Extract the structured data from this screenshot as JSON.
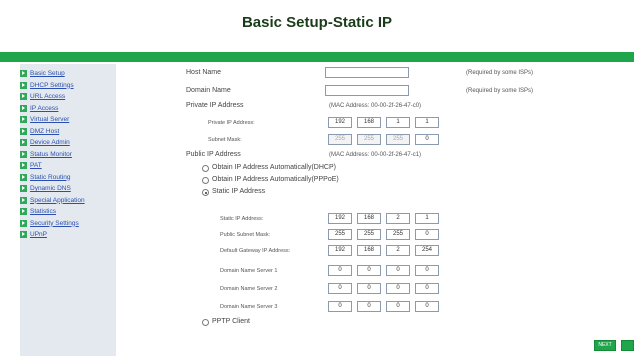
{
  "header": {
    "title": "Basic Setup-Static IP"
  },
  "sidebar": {
    "items": [
      {
        "label": "Basic Setup"
      },
      {
        "label": "DHCP Settings"
      },
      {
        "label": "URL Access"
      },
      {
        "label": "IP Access"
      },
      {
        "label": "Virtual Server"
      },
      {
        "label": "DMZ Host"
      },
      {
        "label": "Device Admin"
      },
      {
        "label": "Status Monitor"
      },
      {
        "label": "PAT"
      },
      {
        "label": "Static Routing"
      },
      {
        "label": "Dynamic DNS"
      },
      {
        "label": "Special Application"
      },
      {
        "label": "Statistics"
      },
      {
        "label": "Security Settings"
      },
      {
        "label": "UPnP"
      }
    ]
  },
  "form": {
    "host_name_label": "Host Name",
    "host_name_value": "",
    "domain_name_label": "Domain Name",
    "domain_name_value": "",
    "required_note_1": "(Required by some ISPs)",
    "required_note_2": "(Required by some ISPs)",
    "private_ip_label": "Private IP Address",
    "private_mac": "(MAC Address: 00-00-2f-26-47-c0)",
    "private_ip_sub_label": "Private IP Address:",
    "private_ip": [
      "192",
      "168",
      "1",
      "1"
    ],
    "subnet_mask_label": "Subnet Mask:",
    "subnet_mask": [
      "255",
      "255",
      "255",
      "0"
    ],
    "public_ip_label": "Public IP Address",
    "public_mac": "(MAC Address: 00-00-2f-26-47-c1)",
    "radio_dhcp": "Obtain IP Address Automatically(DHCP)",
    "radio_pppoe": "Obtain IP Address Automatically(PPPoE)",
    "radio_static": "Static IP Address",
    "radio_pptp": "PPTP Client",
    "static_ip_label": "Static IP Address:",
    "static_ip": [
      "192",
      "168",
      "2",
      "1"
    ],
    "public_mask_label": "Public Subnet Mask:",
    "public_mask": [
      "255",
      "255",
      "255",
      "0"
    ],
    "gateway_label": "Default Gateway IP Address:",
    "gateway": [
      "192",
      "168",
      "2",
      "254"
    ],
    "dns1_label": "Domain Name Server 1",
    "dns1": [
      "0",
      "0",
      "0",
      "0"
    ],
    "dns2_label": "Domain Name Server 2",
    "dns2": [
      "0",
      "0",
      "0",
      "0"
    ],
    "dns3_label": "Domain Name Server 3",
    "dns3": [
      "0",
      "0",
      "0",
      "0"
    ]
  },
  "buttons": {
    "next_label": "NEXT"
  },
  "colors": {
    "accent": "#1fa64a",
    "sidebar_bg": "#e4e9ef",
    "link": "#2a4fb0"
  }
}
